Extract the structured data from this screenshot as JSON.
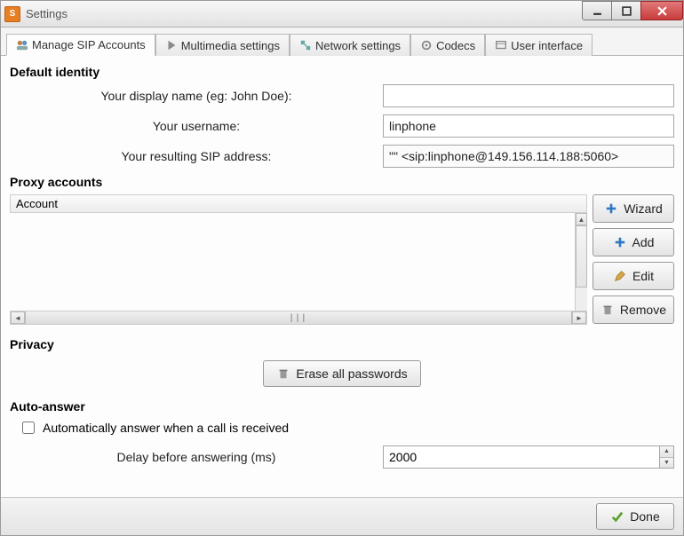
{
  "window": {
    "title": "Settings"
  },
  "tabs": [
    {
      "label": "Manage SIP Accounts"
    },
    {
      "label": "Multimedia settings"
    },
    {
      "label": "Network settings"
    },
    {
      "label": "Codecs"
    },
    {
      "label": "User interface"
    }
  ],
  "identity": {
    "section_title": "Default identity",
    "display_name_label": "Your display name (eg: John Doe):",
    "display_name_value": "",
    "username_label": "Your username:",
    "username_value": "linphone",
    "sip_label": "Your resulting SIP address:",
    "sip_value": "\"\" <sip:linphone@149.156.114.188:5060>"
  },
  "proxy": {
    "section_title": "Proxy accounts",
    "column_header": "Account",
    "buttons": {
      "wizard": "Wizard",
      "add": "Add",
      "edit": "Edit",
      "remove": "Remove"
    }
  },
  "privacy": {
    "section_title": "Privacy",
    "erase_button": "Erase all passwords"
  },
  "autoanswer": {
    "section_title": "Auto-answer",
    "checkbox_label": "Automatically answer when a call is received",
    "checkbox_checked": false,
    "delay_label": "Delay before answering (ms)",
    "delay_value": "2000"
  },
  "footer": {
    "done": "Done"
  }
}
